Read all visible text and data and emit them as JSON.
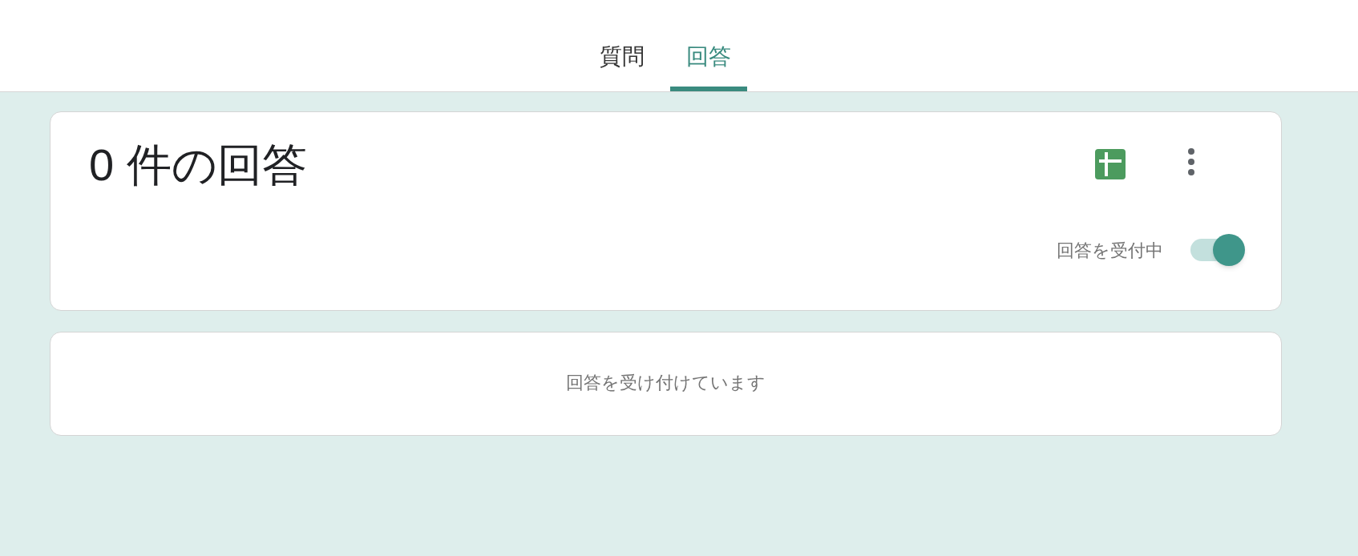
{
  "tabs": [
    {
      "label": "質問",
      "selected": false
    },
    {
      "label": "回答",
      "selected": true
    }
  ],
  "summary": {
    "title": "0 件の回答",
    "accepting": {
      "label": "回答を受付中",
      "on": true
    }
  },
  "message": "回答を受け付けています"
}
